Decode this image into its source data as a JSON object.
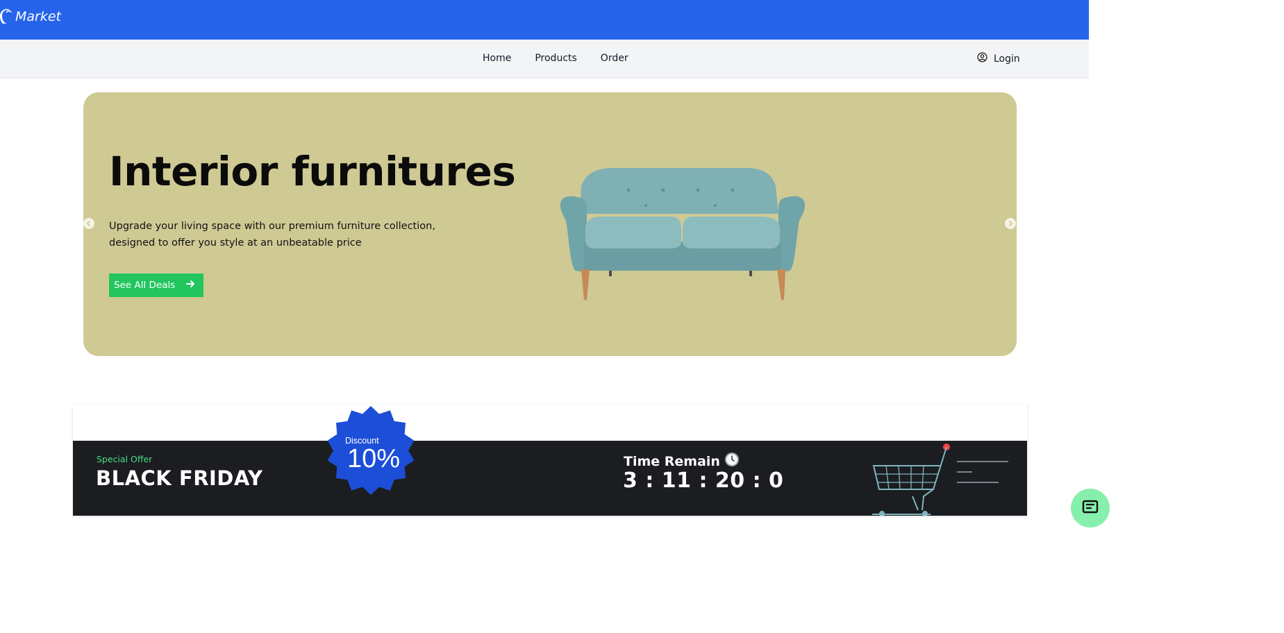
{
  "brand": {
    "name": "Market",
    "icon": "shopping-bag-icon",
    "color": "#2563eb"
  },
  "nav": {
    "items": [
      "Home",
      "Products",
      "Order"
    ],
    "login_label": "Login",
    "login_icon": "user-circle-icon"
  },
  "hero": {
    "title": "Interior furnitures",
    "description": "Upgrade your living space with our premium furniture collection, designed to offer you style at an unbeatable price",
    "cta_label": "See All Deals",
    "background": "#cfc994",
    "cta_color": "#22c55e"
  },
  "offer": {
    "eyebrow": "Special Offer",
    "title": "BLACK FRIDAY",
    "discount_label": "Discount",
    "discount_value": "10%",
    "time_label": "Time Remain",
    "time_value": "3 : 11 : 20 : 0",
    "badge_color": "#1d4ed8",
    "eyebrow_color": "#4ade80"
  }
}
